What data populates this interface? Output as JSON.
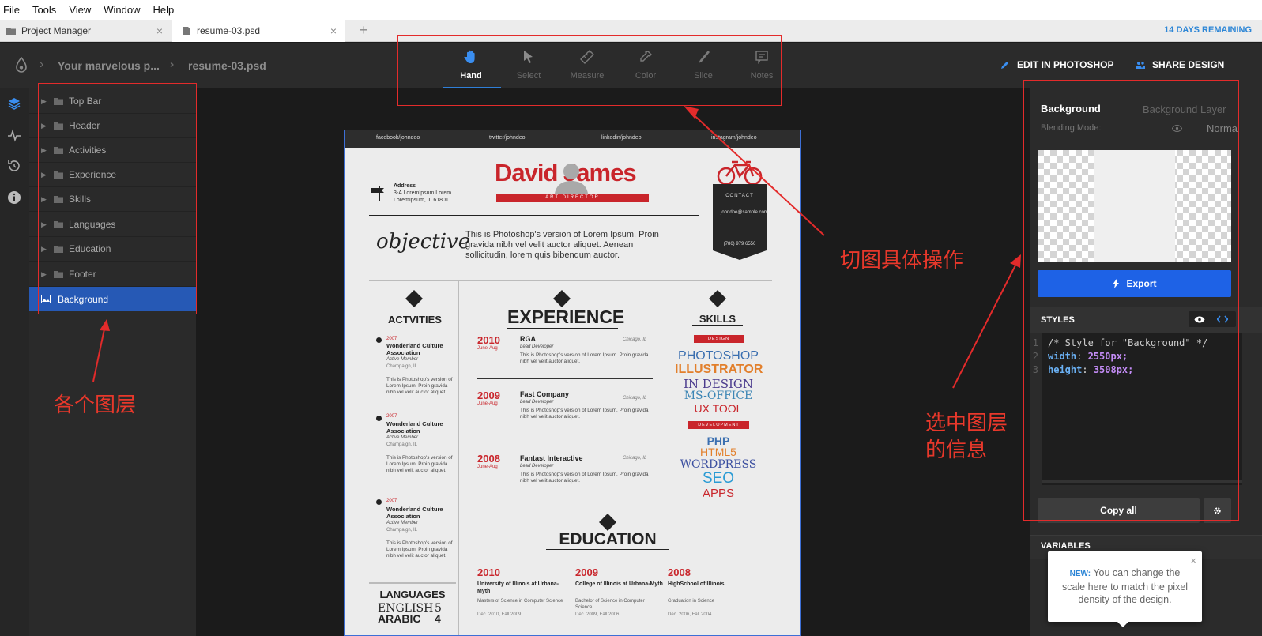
{
  "menu": [
    "File",
    "Tools",
    "View",
    "Window",
    "Help"
  ],
  "tabs": [
    {
      "label": "Project Manager"
    },
    {
      "label": "resume-03.psd"
    }
  ],
  "tab_close": "×",
  "new_tab": "+",
  "trial": "14 DAYS REMAINING",
  "breadcrumb": {
    "project": "Your marvelous p...",
    "file": "resume-03.psd"
  },
  "tools": [
    {
      "label": "Hand",
      "icon": "hand-icon",
      "active": true
    },
    {
      "label": "Select",
      "icon": "select-arrow-icon"
    },
    {
      "label": "Measure",
      "icon": "ruler-icon"
    },
    {
      "label": "Color",
      "icon": "eyedropper-icon"
    },
    {
      "label": "Slice",
      "icon": "knife-icon"
    },
    {
      "label": "Notes",
      "icon": "note-icon"
    }
  ],
  "header_buttons": {
    "edit": "EDIT IN PHOTOSHOP",
    "share": "SHARE DESIGN"
  },
  "layers": [
    "Top Bar",
    "Header",
    "Activities",
    "Experience",
    "Skills",
    "Languages",
    "Education",
    "Footer",
    "Background"
  ],
  "resume": {
    "social": [
      "facebook/johndeo",
      "twitter/johndeo",
      "linkedin/johndeo",
      "instagram/johndeo"
    ],
    "address_label": "Address",
    "address_lines": [
      "3-A LoremIpsum Lorem",
      "LoremIpsum, IL 61801"
    ],
    "name": "David James",
    "role": "ART DIRECTOR",
    "contact_label": "CONTACT",
    "contact_email": "johndoe@sample.com",
    "contact_phone": "(786) 979 6556",
    "objective_heading": "objective",
    "objective_text": "This is Photoshop's version of Lorem Ipsum. Proin gravida nibh vel velit auctor aliquet. Aenean sollicitudin, lorem quis bibendum auctor.",
    "activities_heading": "ACTVITIES",
    "activities": [
      {
        "year": "2007",
        "title": "Wonderland Culture Association",
        "role": "Active Member",
        "place": "Champaign, IL"
      },
      {
        "year": "2007",
        "title": "Wonderland Culture Association",
        "role": "Active Member",
        "place": "Champaign, IL"
      },
      {
        "year": "2007",
        "title": "Wonderland Culture Association",
        "role": "Active Member",
        "place": "Champaign, IL"
      }
    ],
    "activity_text": "This is Photoshop's version of Lorem Ipsum. Proin gravida nibh vel velit auctor aliquet.",
    "experience_heading": "EXPERIENCE",
    "experience": [
      {
        "year": "2010",
        "period": "June-Aug",
        "company": "RGA",
        "role": "Lead Developer",
        "place": "Chicago, IL"
      },
      {
        "year": "2009",
        "period": "June-Aug",
        "company": "Fast Company",
        "role": "Lead Developer",
        "place": "Chicago, IL"
      },
      {
        "year": "2008",
        "period": "June-Aug",
        "company": "Fantast Interactive",
        "role": "Lead Developer",
        "place": "Chicago, IL"
      }
    ],
    "experience_text": "This is Photoshop's version of Lorem Ipsum. Proin gravida nibh vel velit auctor aliquet.",
    "skills_heading": "SKILLS",
    "skills_design_label": "DESIGN",
    "skills_design": [
      "PHOTOSHOP",
      "ILLUSTRATOR",
      "IN DESIGN",
      "MS-OFFICE",
      "UX TOOL"
    ],
    "skills_dev_label": "DEVELOPMENT",
    "skills_dev": [
      "PHP",
      "HTML5",
      "WORDPRESS",
      "SEO",
      "APPS"
    ],
    "education_heading": "EDUCATION",
    "education": [
      {
        "year": "2010",
        "school": "University of Illinois at Urbana-Myth",
        "detail": "Masters of Science in Computer Science",
        "dates": "Dec. 2010, Fall 2009"
      },
      {
        "year": "2009",
        "school": "College of Illinois at Urbana-Myth",
        "detail": "Bachelor of Science in Computer Science",
        "dates": "Dec. 2009, Fall 2006"
      },
      {
        "year": "2008",
        "school": "HighSchool of Illinois",
        "detail": "Graduation in Science",
        "dates": "Dec. 2006, Fall 2004"
      }
    ],
    "languages_heading": "LANGUAGES",
    "languages": [
      {
        "name": "ENGLISH",
        "level": "5"
      },
      {
        "name": "ARABIC",
        "level": "4"
      }
    ]
  },
  "annotations": {
    "layers": "各个图层",
    "tools": "切图具体操作",
    "info_line1": "选中图层",
    "info_line2": "的信息"
  },
  "panel": {
    "layer_name": "Background",
    "layer_type": "Background Layer",
    "blend_label": "Blending Mode:",
    "blend_value": "Normal",
    "export_label": "Export",
    "styles_label": "STYLES",
    "code_lines": [
      {
        "n": "1",
        "text": "/* Style for \"Background\" */"
      },
      {
        "n": "2",
        "prop": "width",
        "value": "2550px;"
      },
      {
        "n": "3",
        "prop": "height",
        "value": "3508px;"
      }
    ],
    "copy_all": "Copy all",
    "variables_label": "VARIABLES"
  },
  "tooltip": {
    "new": "NEW:",
    "text": "You can change the scale here to match the pixel density of the design.",
    "close": "×"
  },
  "colors": {
    "accent": "#2659b5",
    "link": "#2d86d6",
    "annotation": "#e32b2b",
    "resume_red": "#c9252b"
  }
}
